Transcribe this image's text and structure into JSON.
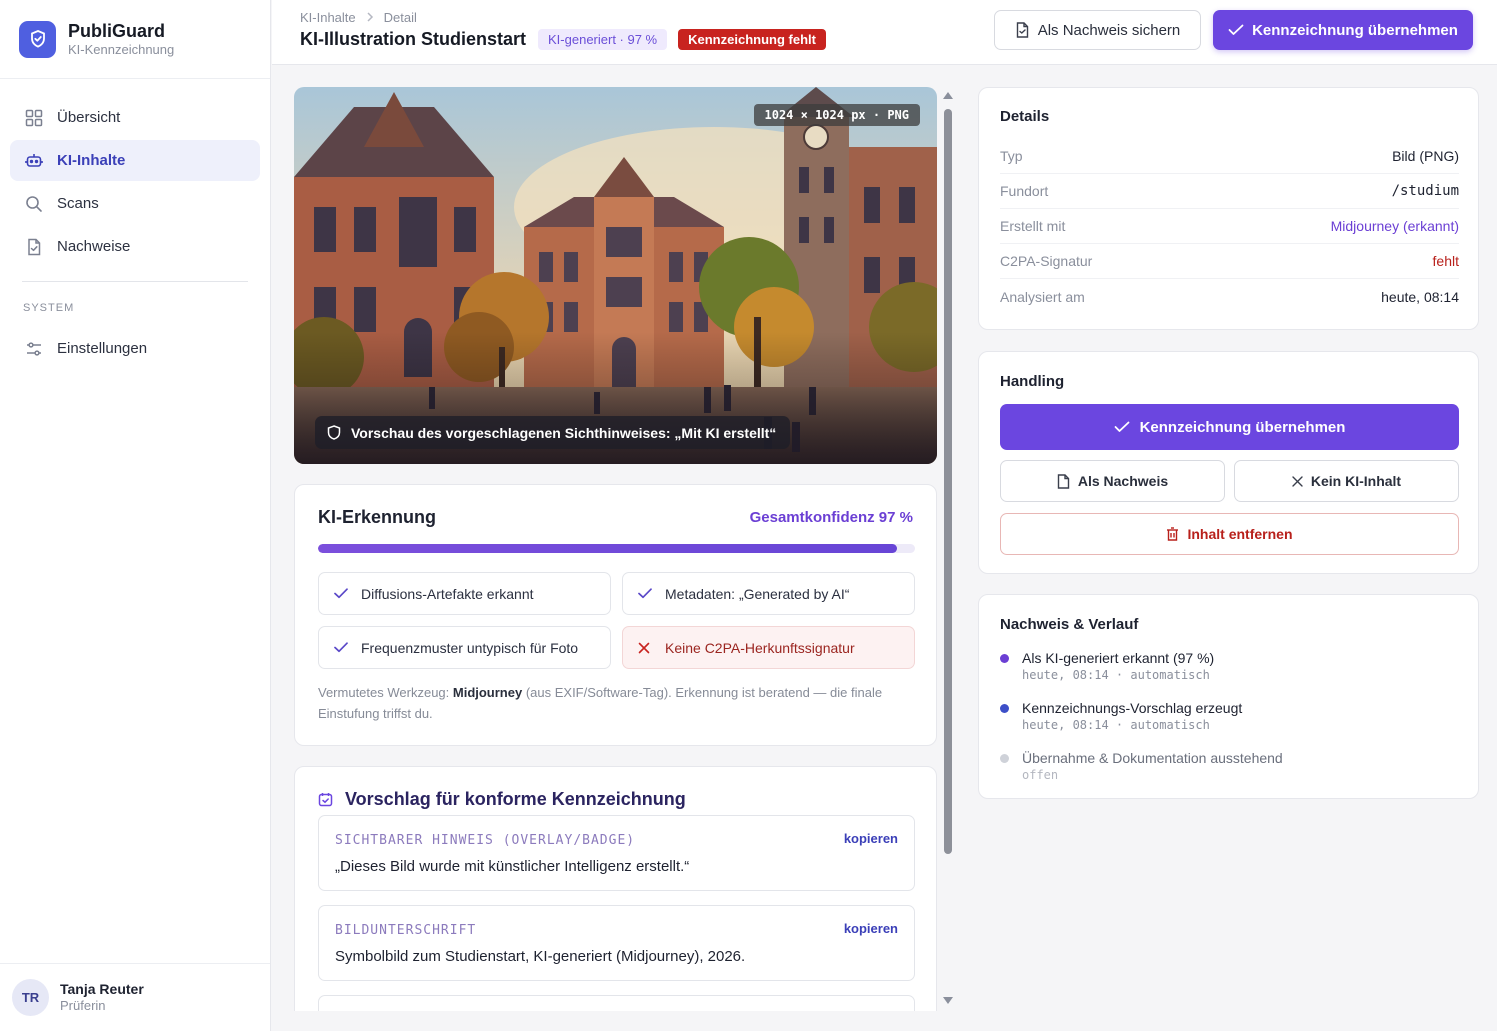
{
  "app": {
    "name": "PubliGuard",
    "subtitle": "KI-Kennzeichnung"
  },
  "sidebar": {
    "items": [
      {
        "label": "Übersicht",
        "icon": "grid-icon"
      },
      {
        "label": "KI-Inhalte",
        "icon": "robot-icon"
      },
      {
        "label": "Scans",
        "icon": "search-icon"
      },
      {
        "label": "Nachweise",
        "icon": "document-check-icon"
      }
    ],
    "section_label": "SYSTEM",
    "system_items": [
      {
        "label": "Einstellungen",
        "icon": "sliders-icon"
      }
    ],
    "user": {
      "initials": "TR",
      "name": "Tanja Reuter",
      "role": "Prüferin"
    }
  },
  "header": {
    "breadcrumb": [
      "KI-Inhalte",
      "Detail"
    ],
    "title": "KI-Illustration Studienstart",
    "badge_ai": "KI-generiert · 97 %",
    "badge_missing": "Kennzeichnung fehlt",
    "btn_save": "Als Nachweis sichern",
    "btn_apply": "Kennzeichnung übernehmen"
  },
  "preview": {
    "dimensions": "1024 × 1024 px · PNG",
    "overlay_hint": "Vorschau des vorgeschlagenen Sichthinweises: „Mit KI erstellt“"
  },
  "detection": {
    "title": "KI-Erkennung",
    "confidence_label": "Gesamtkonfidenz 97 %",
    "confidence": 0.97,
    "checks": [
      {
        "label": "Diffusions-Artefakte erkannt",
        "ok": true
      },
      {
        "label": "Metadaten: „Generated by AI“",
        "ok": true
      },
      {
        "label": "Frequenzmuster untypisch für Foto",
        "ok": true
      },
      {
        "label": "Keine C2PA-Herkunftssignatur",
        "ok": false
      }
    ],
    "note_prefix": "Vermutetes Werkzeug: ",
    "note_tool": "Midjourney",
    "note_suffix": " (aus EXIF/Software-Tag). Erkennung ist beratend — die finale Einstufung triffst du."
  },
  "suggestion": {
    "title": "Vorschlag für konforme Kennzeichnung",
    "items": [
      {
        "label": "SICHTBARER HINWEIS (OVERLAY/BADGE)",
        "copy": "kopieren",
        "text": "„Dieses Bild wurde mit künstlicher Intelligenz erstellt.“"
      },
      {
        "label": "BILDUNTERSCHRIFT",
        "copy": "kopieren",
        "text": "Symbolbild zum Studienstart, KI-generiert (Midjourney), 2026."
      }
    ]
  },
  "details": {
    "title": "Details",
    "rows": [
      {
        "key": "Typ",
        "value": "Bild (PNG)"
      },
      {
        "key": "Fundort",
        "value": "/studium"
      },
      {
        "key": "Erstellt mit",
        "value": "Midjourney (erkannt)"
      },
      {
        "key": "C2PA-Signatur",
        "value": "fehlt"
      },
      {
        "key": "Analysiert am",
        "value": "heute, 08:14"
      }
    ]
  },
  "handling": {
    "title": "Handling",
    "apply": "Kennzeichnung übernehmen",
    "as_proof": "Als Nachweis",
    "not_ai": "Kein KI-Inhalt",
    "remove": "Inhalt entfernen"
  },
  "history": {
    "title": "Nachweis & Verlauf",
    "events": [
      {
        "text": "Als KI-generiert erkannt (97 %)",
        "sub": "heute, 08:14 · automatisch",
        "color": "#6b3fd4"
      },
      {
        "text": "Kennzeichnungs-Vorschlag erzeugt",
        "sub": "heute, 08:14 · automatisch",
        "color": "#3d4fc8"
      },
      {
        "text": "Übernahme & Dokumentation ausstehend",
        "sub": "offen",
        "color": "#cfd2d9"
      }
    ]
  },
  "colors": {
    "accent": "#6b46e0",
    "brand": "#4f5fe0",
    "danger": "#c8231f"
  }
}
